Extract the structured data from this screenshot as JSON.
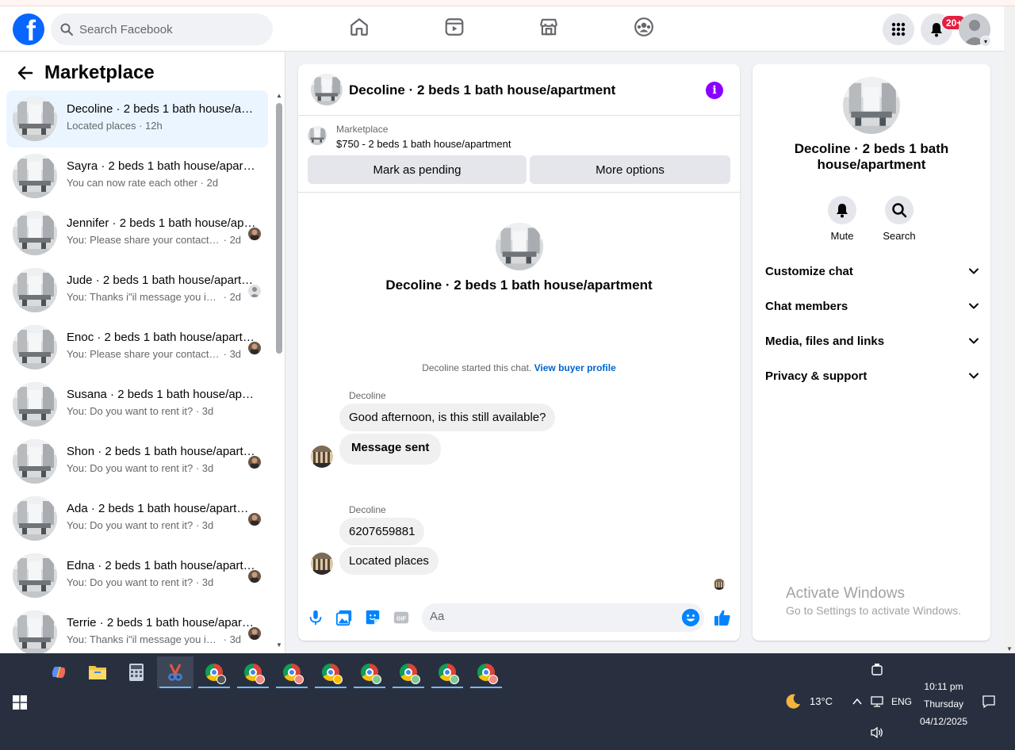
{
  "header": {
    "search_placeholder": "Search Facebook",
    "notification_badge": "20+"
  },
  "sidebar": {
    "title": "Marketplace",
    "conversations": [
      {
        "title": "Decoline · 2 beds 1 bath house/apartment",
        "snippet": "Located places",
        "time": "12h",
        "active": true
      },
      {
        "title": "Sayra · 2 beds 1 bath house/apartment",
        "snippet": "You can now rate each other",
        "time": "2d"
      },
      {
        "title": "Jennifer · 2 beds 1 bath house/apartment",
        "snippet": "You: Please share your contact n...",
        "time": "2d"
      },
      {
        "title": "Jude · 2 beds 1 bath house/apartment",
        "snippet": "You: Thanks i\"il message you in ...",
        "time": "2d"
      },
      {
        "title": "Enoc · 2 beds 1 bath house/apartment",
        "snippet": "You: Please share your contact n...",
        "time": "3d"
      },
      {
        "title": "Susana · 2 beds 1 bath house/apartment",
        "snippet": "You: Do you want to rent it?",
        "time": "3d"
      },
      {
        "title": "Shon · 2 beds 1 bath house/apartment",
        "snippet": "You: Do you want to rent it?",
        "time": "3d"
      },
      {
        "title": "Ada · 2 beds 1 bath house/apartment",
        "snippet": "You: Do you want to rent it?",
        "time": "3d"
      },
      {
        "title": "Edna · 2 beds 1 bath house/apartment",
        "snippet": "You: Do you want to rent it?",
        "time": "3d"
      },
      {
        "title": "Terrie · 2 beds 1 bath house/apartment",
        "snippet": "You: Thanks i\"il message you in ...",
        "time": "3d"
      }
    ]
  },
  "chat": {
    "title": "Decoline · 2 beds 1 bath house/apartment",
    "listing_label": "Marketplace",
    "listing_price": "$750 - 2 beds 1 bath house/apartment",
    "mark_pending": "Mark as pending",
    "more_options": "More options",
    "center_title": "Decoline · 2 beds 1 bath house/apartment",
    "started_text": "Decoline started this chat. ",
    "view_buyer": "View buyer profile",
    "group1_sender": "Decoline",
    "msg1": "Good afternoon, is this still available?",
    "msg2": "Message sent",
    "group2_sender": "Decoline",
    "msg3": "6207659881",
    "msg4": "Located places",
    "composer_placeholder": "Aa"
  },
  "details": {
    "title": "Decoline · 2 beds 1 bath house/apartment",
    "mute": "Mute",
    "search": "Search",
    "sections": [
      "Customize chat",
      "Chat members",
      "Media, files and links",
      "Privacy & support"
    ]
  },
  "watermark": {
    "line1": "Activate Windows",
    "line2": "Go to Settings to activate Windows."
  },
  "taskbar": {
    "weather": "13°C",
    "language": "ENG",
    "time": "10:11 pm",
    "day": "Thursday",
    "date": "04/12/2025"
  },
  "colors": {
    "brand": "#0866ff",
    "messenger_accent": "#0084ff",
    "info_purple": "#8a00ff",
    "badge_red": "#e41e3f",
    "taskbar_bg": "#283040"
  }
}
